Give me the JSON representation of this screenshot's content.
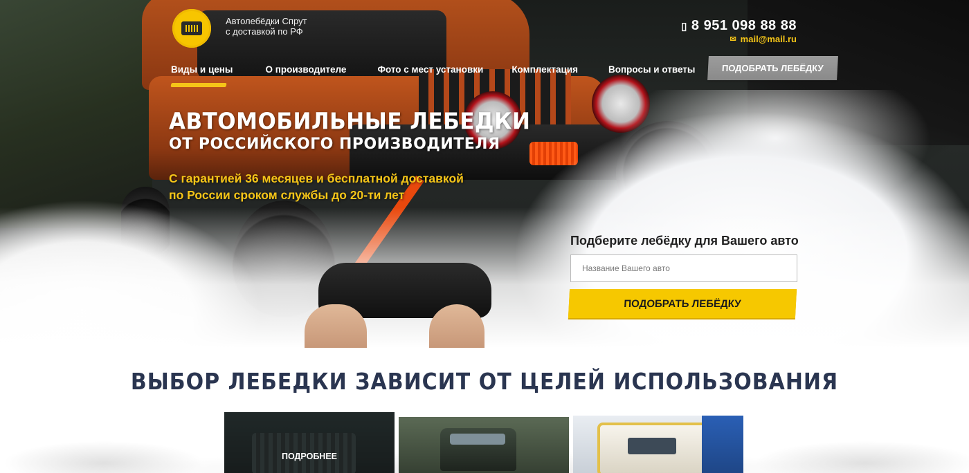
{
  "header": {
    "brand_line1": "Автолебёдки Спрут",
    "brand_line2": "с доставкой по РФ",
    "phone": "8 951 098 88 88",
    "email": "mail@mail.ru",
    "icons": {
      "logo": "winch-logo-icon",
      "phone": "phone-icon",
      "email": "envelope-icon"
    }
  },
  "nav": {
    "items": [
      {
        "label": "Виды и цены",
        "active": true
      },
      {
        "label": "О производителе"
      },
      {
        "label": "Фото с мест установки"
      },
      {
        "label": "Комплектация"
      },
      {
        "label": "Вопросы и ответы"
      }
    ],
    "cta": "ПОДОБРАТЬ ЛЕБЁДКУ"
  },
  "hero": {
    "title_line1": "АВТОМОБИЛЬНЫЕ ЛЕБЕДКИ",
    "title_line2": "ОТ РОССИЙСКОГО ПРОИЗВОДИТЕЛЯ",
    "subtitle": "С гарантией 36 месяцев и бесплатной доставкой по России сроком службы до 20-ти лет"
  },
  "form": {
    "title": "Подберите лебёдку для Вашего авто",
    "input_placeholder": "Название Вашего авто",
    "input_value": "",
    "button": "ПОДОБРАТЬ ЛЕБЁДКУ"
  },
  "section": {
    "title": "ВЫБОР ЛЕБЕДКИ ЗАВИСИТ ОТ ЦЕЛЕЙ ИСПОЛЬЗОВАНИЯ",
    "cards": [
      {
        "label": "ПОДРОБНЕЕ"
      },
      {
        "label": ""
      },
      {
        "label": ""
      }
    ]
  },
  "colors": {
    "accent_yellow": "#f6c800",
    "nav_cta_gray": "#8f8f8f",
    "section_title": "#2a3550"
  }
}
